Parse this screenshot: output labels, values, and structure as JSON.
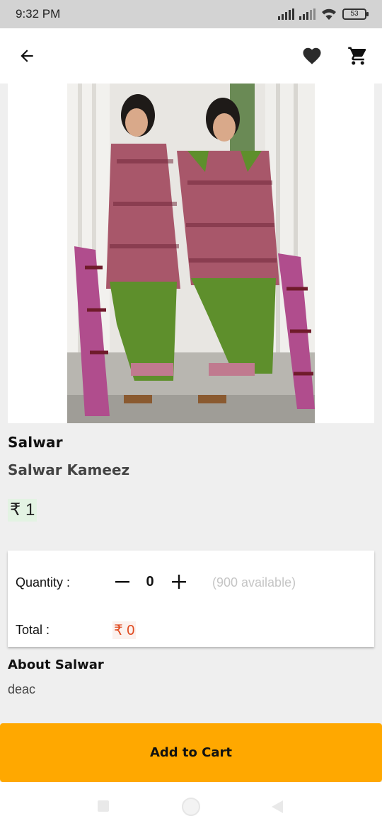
{
  "status_bar": {
    "time": "9:32 PM",
    "battery": "53"
  },
  "app_bar": {
    "icons": [
      "arrow-back-icon",
      "heart-icon",
      "cart-icon"
    ]
  },
  "product": {
    "name": "Salwar",
    "subtitle": "Salwar Kameez",
    "price": "₹ 1"
  },
  "quantity": {
    "label": "Quantity :",
    "value": "0",
    "available": "(900 available)",
    "total_label": "Total :",
    "total_value": "₹ 0"
  },
  "about": {
    "title": "About Salwar",
    "description": "deac"
  },
  "add_to_cart": {
    "label": "Add to Cart"
  },
  "colors": {
    "accent": "#ffa800",
    "price_total": "#e04a1f",
    "price_bg": "#e3f3e3"
  }
}
